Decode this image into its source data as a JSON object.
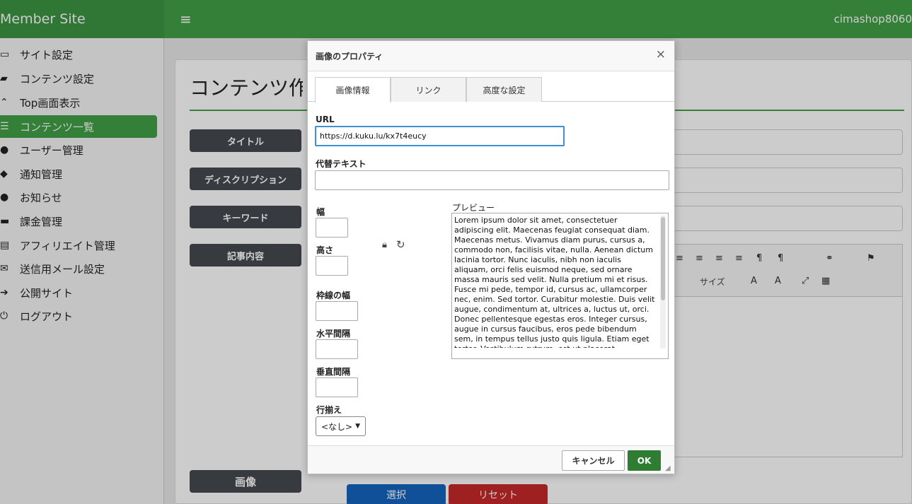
{
  "app": {
    "brand": "Member Site",
    "user": "cimashop8060"
  },
  "sidebar": {
    "items": [
      {
        "label": "サイト設定",
        "icon": "card-icon",
        "glyph": "▭"
      },
      {
        "label": "コンテンツ設定",
        "icon": "folder-plus-icon",
        "glyph": "▰"
      },
      {
        "label": "Top画面表示",
        "icon": "chevrons-up-icon",
        "glyph": "⌃"
      },
      {
        "label": "コンテンツ一覧",
        "icon": "list-icon",
        "glyph": "☰"
      },
      {
        "label": "ユーザー管理",
        "icon": "users-icon",
        "glyph": "●"
      },
      {
        "label": "通知管理",
        "icon": "bell-icon",
        "glyph": "◆"
      },
      {
        "label": "お知らせ",
        "icon": "comment-icon",
        "glyph": "●"
      },
      {
        "label": "課金管理",
        "icon": "money-icon",
        "glyph": "▬"
      },
      {
        "label": "アフィリエイト管理",
        "icon": "document-icon",
        "glyph": "▤"
      },
      {
        "label": "送信用メール設定",
        "icon": "envelope-icon",
        "glyph": "✉"
      },
      {
        "label": "公開サイト",
        "icon": "arrow-circle-icon",
        "glyph": "➔"
      },
      {
        "label": "ログアウト",
        "icon": "power-icon",
        "glyph": "⏻"
      }
    ]
  },
  "content": {
    "page_title": "コンテンツ作",
    "labels": {
      "title": "タイトル",
      "description": "ディスクリプション",
      "keyword": "キーワード",
      "body": "記事内容",
      "image": "画像"
    },
    "editor": {
      "size": "サイズ"
    },
    "select": "選択",
    "reset": "リセット"
  },
  "dialog": {
    "title": "画像のプロパティ",
    "close": "×",
    "tabs": [
      "画像情報",
      "リンク",
      "高度な設定"
    ],
    "url_label": "URL",
    "url_value": "https://d.kuku.lu/kx7t4eucy",
    "alt_label": "代替テキスト",
    "width_label": "幅",
    "height_label": "高さ",
    "border_label": "枠線の幅",
    "hspace_label": "水平間隔",
    "vspace_label": "垂直間隔",
    "align_label": "行揃え",
    "align_value": "<なし>",
    "preview_label": "プレビュー",
    "preview_text": "Lorem ipsum dolor sit amet, consectetuer adipiscing elit. Maecenas feugiat consequat diam. Maecenas metus. Vivamus diam purus, cursus a, commodo non, facilisis vitae, nulla. Aenean dictum lacinia tortor. Nunc iaculis, nibh non iaculis aliquam, orci felis euismod neque, sed ornare massa mauris sed velit. Nulla pretium mi et risus. Fusce mi pede, tempor id, cursus ac, ullamcorper nec, enim. Sed tortor. Curabitur molestie. Duis velit augue, condimentum at, ultrices a, luctus ut, orci. Donec pellentesque egestas eros. Integer cursus, augue in cursus faucibus, eros pede bibendum sem, in tempus tellus justo quis ligula. Etiam eget tortor. Vestibulum rutrum, est ut placerat elementum, lectus nisl aliquam velit, tempor",
    "cancel": "キャンセル",
    "ok": "OK"
  }
}
